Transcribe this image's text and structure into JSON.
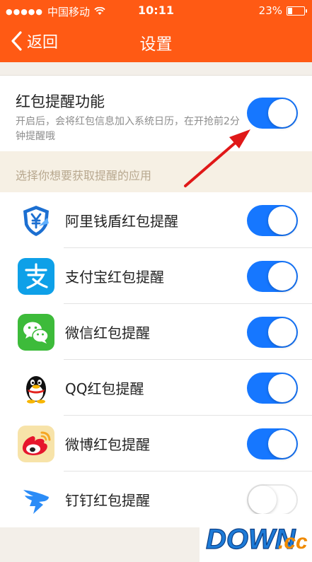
{
  "status_bar": {
    "signal_dots": "●●●●●",
    "carrier": "中国移动",
    "wifi_icon": "wifi-icon",
    "time": "10:11",
    "battery_percent": "23%",
    "battery_level": 0.23
  },
  "nav": {
    "back_label": "返回",
    "title": "设置"
  },
  "main_setting": {
    "label": "红包提醒功能",
    "description": "开启后，会将红包信息加入系统日历，在开抢前2分钟提醒哦",
    "enabled": true
  },
  "section_header": "选择你想要获取提醒的应用",
  "apps": [
    {
      "label": "阿里钱盾红包提醒",
      "icon": "aliqiandun-shield-icon",
      "enabled": true
    },
    {
      "label": "支付宝红包提醒",
      "icon": "alipay-icon",
      "enabled": true
    },
    {
      "label": "微信红包提醒",
      "icon": "wechat-icon",
      "enabled": true
    },
    {
      "label": "QQ红包提醒",
      "icon": "qq-penguin-icon",
      "enabled": true
    },
    {
      "label": "微博红包提醒",
      "icon": "weibo-icon",
      "enabled": true
    },
    {
      "label": "钉钉红包提醒",
      "icon": "dingtalk-icon",
      "enabled": false
    }
  ],
  "colors": {
    "brand_orange": "#ff5a14",
    "toggle_blue": "#1677ff",
    "annotation_arrow": "#e01818"
  },
  "watermark": {
    "text_main": "DOWN",
    "text_suffix": ".cc"
  }
}
